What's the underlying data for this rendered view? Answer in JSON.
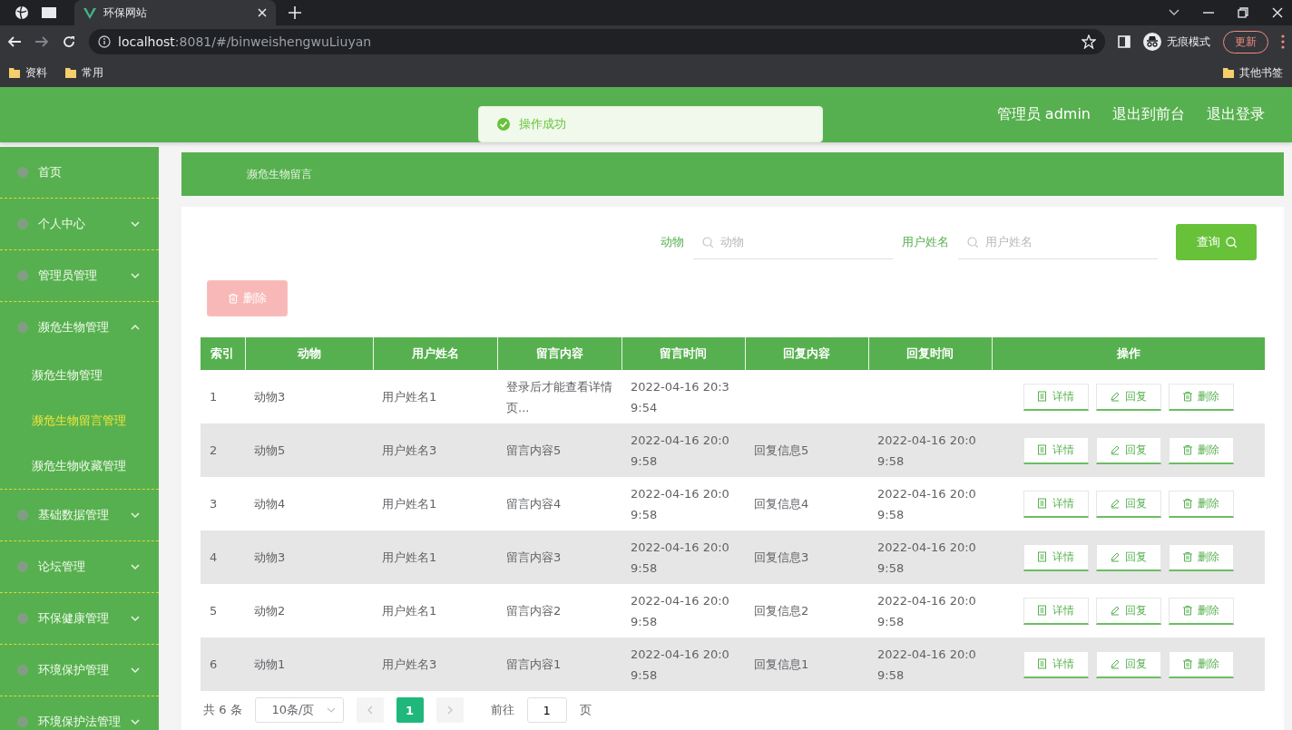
{
  "browser": {
    "tabs": [
      {
        "title": "环保网站",
        "selected": true
      }
    ],
    "url_host": "localhost",
    "url_rest": ":8081/#/binweishengwuLiuyan",
    "incognito_label": "无痕模式",
    "update_button": "更新",
    "bookmarks": [
      "资料",
      "常用"
    ],
    "other_bookmarks": "其他书签"
  },
  "header": {
    "user": "管理员 admin",
    "links": [
      "退出到前台",
      "退出登录"
    ]
  },
  "toast": {
    "text": "操作成功"
  },
  "sidebar": {
    "items": [
      {
        "label": "首页",
        "selected": false
      },
      {
        "label": "个人中心",
        "expanded": false,
        "selected": false
      },
      {
        "label": "管理员管理",
        "expanded": false,
        "selected": false
      },
      {
        "label": "濒危生物管理",
        "expanded": true,
        "selected": false,
        "children": [
          {
            "label": "濒危生物管理",
            "selected": false
          },
          {
            "label": "濒危生物留言管理",
            "selected": true
          },
          {
            "label": "濒危生物收藏管理",
            "selected": false
          }
        ]
      },
      {
        "label": "基础数据管理",
        "expanded": false,
        "selected": false
      },
      {
        "label": "论坛管理",
        "expanded": false,
        "selected": false
      },
      {
        "label": "环保健康管理",
        "expanded": false,
        "selected": false
      },
      {
        "label": "环境保护管理",
        "expanded": false,
        "selected": false
      },
      {
        "label": "环境保护法管理",
        "expanded": false,
        "selected": false
      }
    ]
  },
  "breadcrumb": "濒危生物留言",
  "search": {
    "fields": [
      {
        "label": "动物",
        "placeholder": "动物"
      },
      {
        "label": "用户姓名",
        "placeholder": "用户姓名"
      }
    ],
    "button": "查询"
  },
  "delete_button": {
    "label": "删除",
    "disabled": true
  },
  "table": {
    "columns": [
      "索引",
      "动物",
      "用户姓名",
      "留言内容",
      "留言时间",
      "回复内容",
      "回复时间",
      "操作"
    ],
    "rows": [
      {
        "cells": [
          "1",
          "动物3",
          "用户姓名1",
          "登录后才能查看详情页...",
          "2022-04-16 20:39:54"
        ],
        "actions": [
          "详情",
          "回复",
          "删除"
        ]
      },
      {
        "cells": [
          "2",
          "动物5",
          "用户姓名3",
          "留言内容5",
          "2022-04-16 20:09:58",
          "回复信息5",
          "2022-04-16 20:09:58"
        ],
        "actions": [
          "详情",
          "回复",
          "删除"
        ]
      },
      {
        "cells": [
          "3",
          "动物4",
          "用户姓名1",
          "留言内容4",
          "2022-04-16 20:09:58",
          "回复信息4",
          "2022-04-16 20:09:58"
        ],
        "actions": [
          "详情",
          "回复",
          "删除"
        ]
      },
      {
        "cells": [
          "4",
          "动物3",
          "用户姓名1",
          "留言内容3",
          "2022-04-16 20:09:58",
          "回复信息3",
          "2022-04-16 20:09:58"
        ],
        "actions": [
          "详情",
          "回复",
          "删除"
        ]
      },
      {
        "cells": [
          "5",
          "动物2",
          "用户姓名1",
          "留言内容2",
          "2022-04-16 20:09:58",
          "回复信息2",
          "2022-04-16 20:09:58"
        ],
        "actions": [
          "详情",
          "回复",
          "删除"
        ]
      },
      {
        "cells": [
          "6",
          "动物1",
          "用户姓名3",
          "留言内容1",
          "2022-04-16 20:09:58",
          "回复信息1",
          "2022-04-16 20:09:58"
        ],
        "actions": [
          "详情",
          "回复",
          "删除"
        ]
      }
    ]
  },
  "pagination": {
    "total": "共 6 条",
    "page_size": "10条/页",
    "pages": [
      {
        "label": "1",
        "selected": true
      }
    ],
    "goto_label": "前往",
    "goto_value": "1",
    "goto_suffix": "页"
  }
}
